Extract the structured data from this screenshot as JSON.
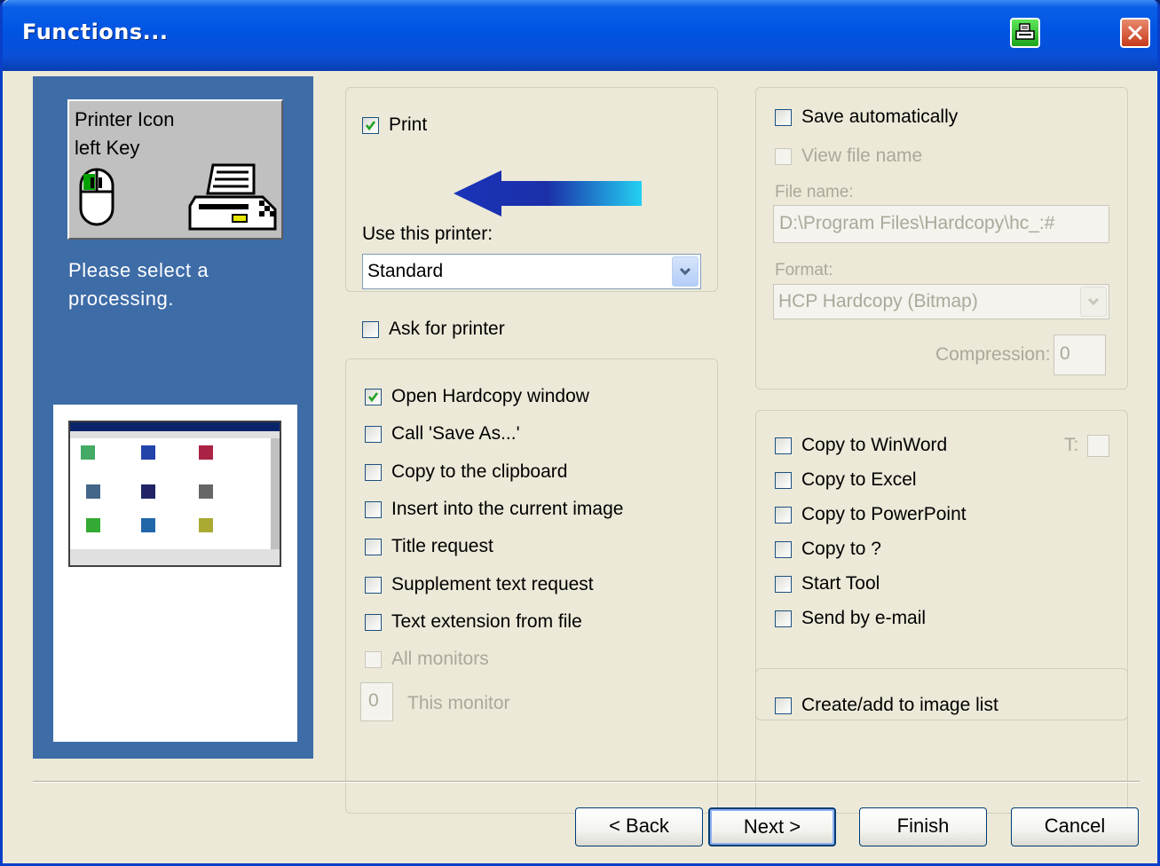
{
  "window": {
    "title": "Functions..."
  },
  "left": {
    "box_line1": "Printer Icon",
    "box_line2": "left Key",
    "message_line1": "Please select a",
    "message_line2": "processing."
  },
  "print_group": {
    "print_label": "Print",
    "print_checked": true,
    "use_printer_label": "Use this printer:",
    "printer_value": "Standard",
    "ask_label": "Ask for printer"
  },
  "options": [
    {
      "label": "Open Hardcopy window",
      "checked": true
    },
    {
      "label": "Call 'Save As...'",
      "checked": false
    },
    {
      "label": "Copy to the clipboard",
      "checked": false
    },
    {
      "label": "Insert into the current image",
      "checked": false
    },
    {
      "label": "Title request",
      "checked": false
    },
    {
      "label": "Supplement text request",
      "checked": false
    },
    {
      "label": "Text extension from file",
      "checked": false
    },
    {
      "label": "All monitors",
      "checked": false,
      "disabled": true
    }
  ],
  "monitor": {
    "value": "0",
    "label": "This monitor"
  },
  "save_group": {
    "save_auto_label": "Save automatically",
    "view_file_label": "View file name",
    "file_name_label": "File name:",
    "file_name_value": "D:\\Program Files\\Hardcopy\\hc_:#",
    "format_label": "Format:",
    "format_value": "HCP  Hardcopy (Bitmap)",
    "compression_label": "Compression:",
    "compression_value": "0"
  },
  "copy_group": {
    "t_label": "T:",
    "items": [
      {
        "label": "Copy to WinWord"
      },
      {
        "label": "Copy to Excel"
      },
      {
        "label": "Copy to PowerPoint"
      },
      {
        "label": "Copy to ?"
      },
      {
        "label": "Start Tool"
      },
      {
        "label": "Send by e-mail"
      }
    ]
  },
  "image_list_label": "Create/add to image list",
  "buttons": {
    "back": "< Back",
    "next": "Next >",
    "finish": "Finish",
    "cancel": "Cancel"
  }
}
